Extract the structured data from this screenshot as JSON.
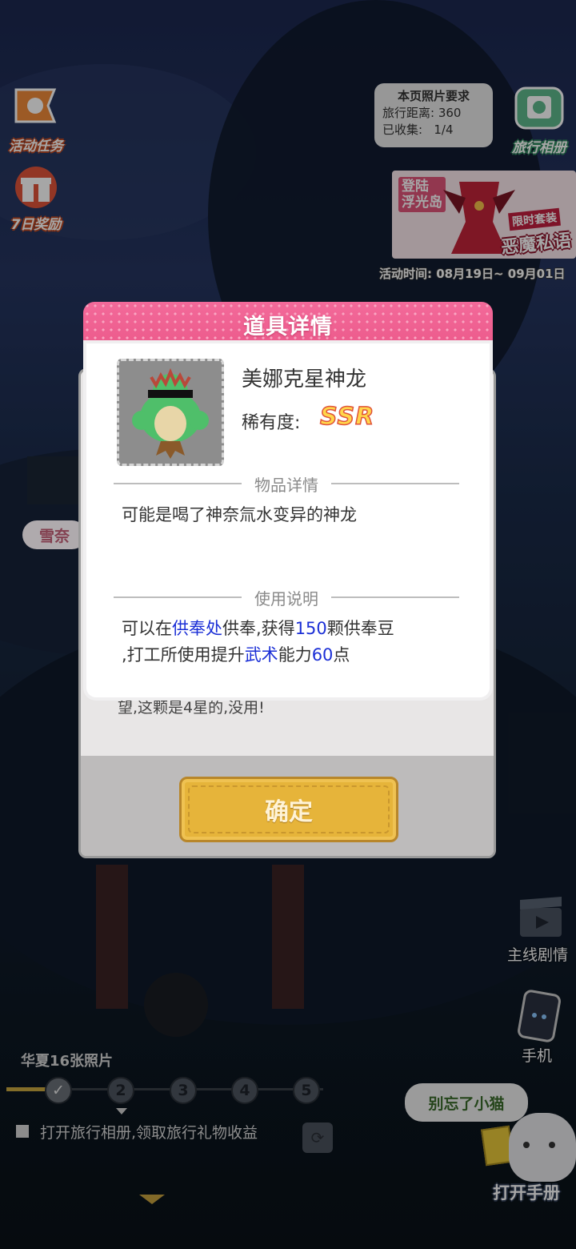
{
  "left_buttons": [
    {
      "label": "活动任务",
      "icon": "flag-icon"
    },
    {
      "label": "7日奖励",
      "icon": "gift-icon"
    }
  ],
  "photo_requirement": {
    "title": "本页照片要求",
    "distance_label": "旅行距离:",
    "distance_value": "360",
    "collected_label": "已收集:",
    "collected_value": "1/4"
  },
  "album_button": {
    "label": "旅行相册",
    "icon": "camera-icon"
  },
  "promo_banner": {
    "line1": "登陆",
    "line2": "浮光岛",
    "tag": "限时套装",
    "title": "恶魔私语"
  },
  "activity_time": "活动时间: 08月19日~ 09月01日",
  "back_dialog": {
    "snow_label": "雪奈",
    "text": "望,这颗是4星的,没用!",
    "confirm_label": "确定"
  },
  "item_detail": {
    "header": "道具详情",
    "item_name": "美娜克星神龙",
    "rarity_label": "稀有度:",
    "rarity_value": "SSR",
    "detail_title": "物品详情",
    "description": "可能是喝了神奈氚水变异的神龙",
    "usage_title": "使用说明",
    "usage": {
      "p1": "可以在",
      "h1": "供奉处",
      "p2": "供奉,获得",
      "h2": "150",
      "p3": "颗供奉豆",
      "p4": ",打工所使用提升",
      "h3": "武术",
      "p5": "能力",
      "h4": "60",
      "p6": "点"
    }
  },
  "bottom": {
    "photos_label": "华夏16张照片",
    "steps": [
      "2",
      "3",
      "4",
      "5"
    ],
    "hint": "打开旅行相册,领取旅行礼物收益",
    "cat_bubble": "别忘了小猫",
    "main_story": "主线剧情",
    "phone": "手机",
    "open_manual": "打开手册"
  }
}
